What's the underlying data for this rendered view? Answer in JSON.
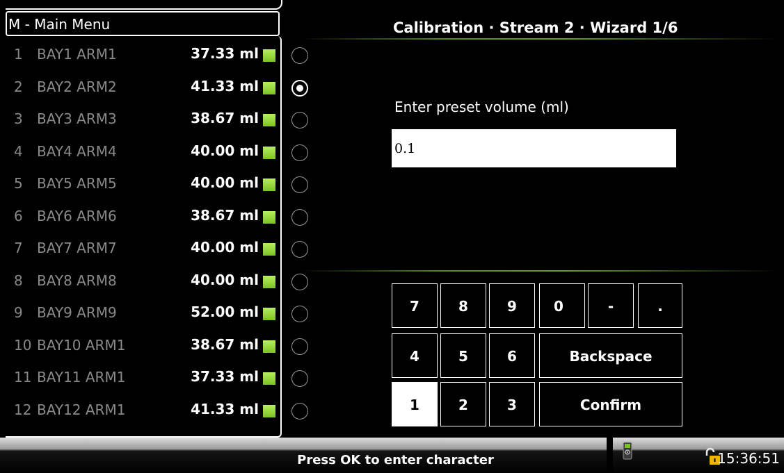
{
  "menu": {
    "title": "M - Main Menu"
  },
  "streams": [
    {
      "num": "1",
      "name": "BAY1 ARM1",
      "volume": "37.33 ml",
      "selected": false
    },
    {
      "num": "2",
      "name": "BAY2 ARM2",
      "volume": "41.33 ml",
      "selected": true
    },
    {
      "num": "3",
      "name": "BAY3 ARM3",
      "volume": "38.67 ml",
      "selected": false
    },
    {
      "num": "4",
      "name": "BAY4 ARM4",
      "volume": "40.00 ml",
      "selected": false
    },
    {
      "num": "5",
      "name": "BAY5 ARM5",
      "volume": "40.00 ml",
      "selected": false
    },
    {
      "num": "6",
      "name": "BAY6 ARM6",
      "volume": "38.67 ml",
      "selected": false
    },
    {
      "num": "7",
      "name": "BAY7 ARM7",
      "volume": "40.00 ml",
      "selected": false
    },
    {
      "num": "8",
      "name": "BAY8 ARM8",
      "volume": "40.00 ml",
      "selected": false
    },
    {
      "num": "9",
      "name": "BAY9 ARM9",
      "volume": "52.00 ml",
      "selected": false
    },
    {
      "num": "10",
      "name": "BAY10 ARM1",
      "volume": "38.67 ml",
      "selected": false
    },
    {
      "num": "11",
      "name": "BAY11 ARM1",
      "volume": "37.33 ml",
      "selected": false
    },
    {
      "num": "12",
      "name": "BAY12 ARM1",
      "volume": "41.33 ml",
      "selected": false
    }
  ],
  "wizard": {
    "title": "Calibration · Stream 2 · Wizard 1/6",
    "prompt": "Enter preset volume (ml)",
    "input_value": "0.1"
  },
  "keypad": {
    "k7": "7",
    "k8": "8",
    "k9": "9",
    "k0": "0",
    "kminus": "-",
    "kdot": ".",
    "k4": "4",
    "k5": "5",
    "k6": "6",
    "backspace": "Backspace",
    "k1": "1",
    "k2": "2",
    "k3": "3",
    "confirm": "Confirm"
  },
  "status_bar": {
    "message": "Press OK to enter character",
    "time": "15:36:51"
  },
  "colors": {
    "status_ok": "#8fd63a",
    "accent_line": "#6aa020",
    "lock": "#f0b400"
  }
}
